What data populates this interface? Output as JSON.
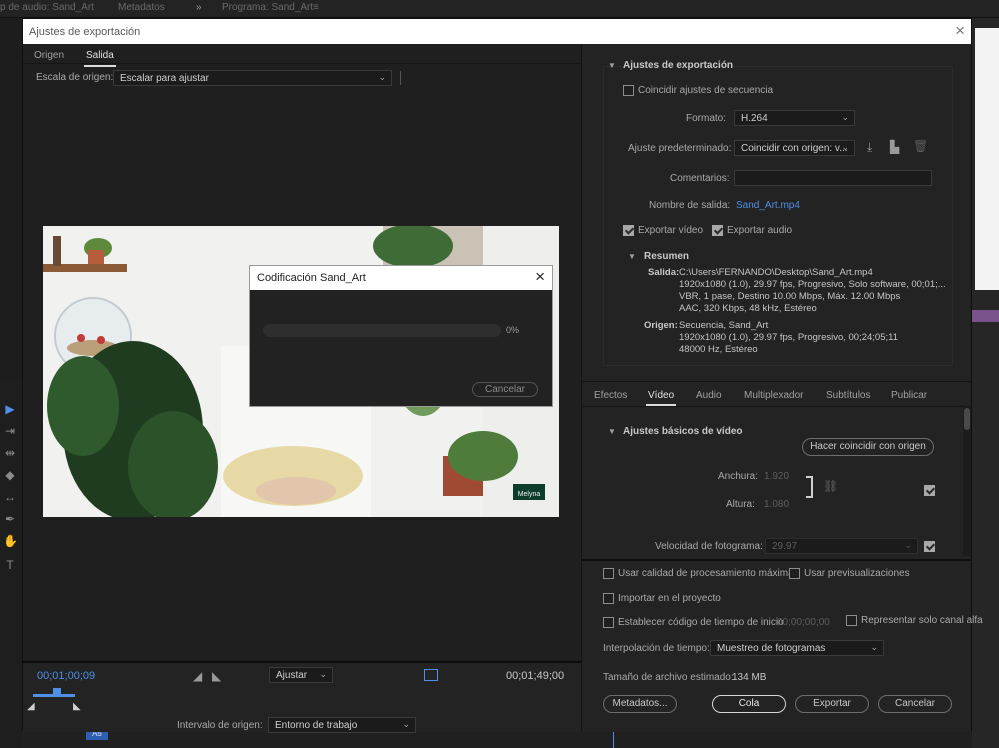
{
  "background": {
    "audio_panel": "p de audio: Sand_Art",
    "metadata": "Metadatos",
    "program": "Programa: Sand_Art"
  },
  "dialog": {
    "title": "Ajustes de exportación",
    "source_tabs": [
      "Origen",
      "Salida"
    ],
    "source_scale_label": "Escala de origen:",
    "source_scale_value": "Escalar para ajustar",
    "watermark_text": "Melyna",
    "encoding": {
      "title": "Codificación Sand_Art",
      "progress": 0,
      "progress_text": "0%",
      "cancel": "Cancelar"
    },
    "transport": {
      "timecode_in": "00;01;00;09",
      "fit": "Ajustar",
      "timecode_out": "00;01;49;00",
      "range_label": "Intervalo de origen:",
      "range_value": "Entorno de trabajo"
    },
    "export": {
      "section": "Ajustes de exportación",
      "match_sequence": "Coincidir ajustes de secuencia",
      "format_label": "Formato:",
      "format_value": "H.264",
      "preset_label": "Ajuste predeterminado:",
      "preset_value": "Coincidir con origen: v...",
      "comments_label": "Comentarios:",
      "output_label": "Nombre de salida:",
      "output_value": "Sand_Art.mp4",
      "export_video": "Exportar vídeo",
      "export_audio": "Exportar audio",
      "summary": "Resumen",
      "output_summary_label": "Salida:",
      "output_summary": [
        "C:\\Users\\FERNANDO\\Desktop\\Sand_Art.mp4",
        "1920x1080 (1.0), 29.97 fps, Progresivo, Solo software, 00;01;...",
        "VBR, 1 pase, Destino 10.00 Mbps, Máx. 12.00 Mbps",
        "AAC, 320 Kbps, 48 kHz, Estéreo"
      ],
      "source_summary_label": "Origen:",
      "source_summary": [
        "Secuencia, Sand_Art",
        "1920x1080 (1.0), 29.97 fps, Progresivo, 00;24;05;11",
        "48000 Hz, Estéreo"
      ]
    },
    "tabs": [
      "Efectos",
      "Vídeo",
      "Audio",
      "Multiplexador",
      "Subtítulos",
      "Publicar"
    ],
    "video": {
      "section": "Ajustes básicos de vídeo",
      "match_source": "Hacer coincidir con origen",
      "width_label": "Anchura:",
      "width_value": "1.920",
      "height_label": "Altura:",
      "height_value": "1.080",
      "fps_label": "Velocidad de fotograma:",
      "fps_value": "29.97"
    },
    "bottom": {
      "max_quality": "Usar calidad de procesamiento máxima",
      "use_previews": "Usar previsualizaciones",
      "import_project": "Importar en el proyecto",
      "set_timecode": "Establecer código de tiempo de inicio",
      "timecode_value": "00;00;00;00",
      "alpha_only": "Representar solo canal alfa",
      "interp_label": "Interpolación de tiempo:",
      "interp_value": "Muestreo de fotogramas",
      "size_label": "Tamaño de archivo estimado:",
      "size_value": "134 MB",
      "metadata_btn": "Metadatos...",
      "queue_btn": "Cola",
      "export_btn": "Exportar",
      "cancel_btn": "Cancelar"
    }
  },
  "track": {
    "label": "A5"
  },
  "colors": {
    "accent": "#4f8fe6",
    "panel": "#232323",
    "dark": "#1f1f1f"
  }
}
